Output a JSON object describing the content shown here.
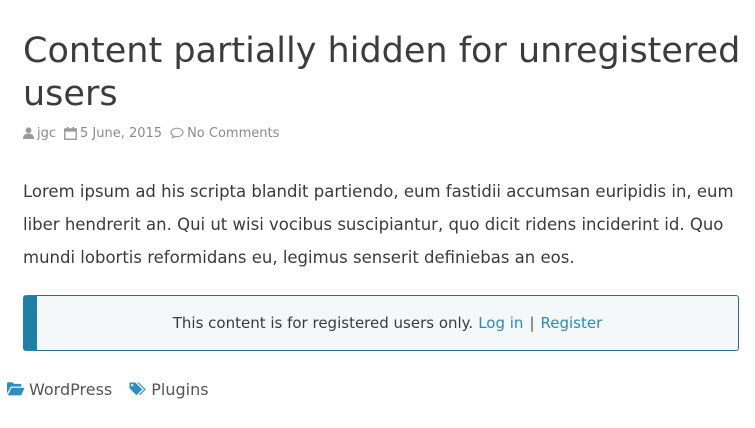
{
  "post": {
    "title": "Content partially hidden for unregistered users",
    "meta": {
      "author": "jgc",
      "date": "5 June, 2015",
      "comments": "No Comments"
    },
    "body": "Lorem ipsum ad his scripta blandit partiendo, eum fastidii accumsan euripidis in, eum liber hendrerit an. Qui ut wisi vocibus suscipiantur, quo dicit ridens inciderint id. Quo mundi lobortis reformidans eu, legimus senserit definiebas an eos.",
    "restricted_notice": {
      "message": "This content is for registered users only.",
      "login_label": "Log in",
      "separator": "|",
      "register_label": "Register"
    },
    "category": "WordPress",
    "tag": "Plugins"
  },
  "colors": {
    "link": "#2a8ab8",
    "notice_accent": "#1f7fa8",
    "icon_blue": "#2b8fc4"
  },
  "icons": {
    "author": "user-icon",
    "date": "calendar-icon",
    "comments": "comment-icon",
    "category": "folder-open-icon",
    "tag": "tags-icon"
  }
}
